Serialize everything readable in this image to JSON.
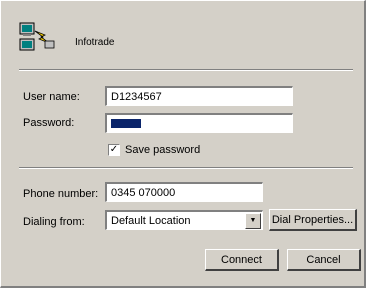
{
  "connection": {
    "name": "Infotrade"
  },
  "fields": {
    "username_label": "User name:",
    "username_value": "D1234567",
    "password_label": "Password:",
    "save_password_label": "Save password",
    "save_password_checked": true,
    "phone_label": "Phone number:",
    "phone_value": "0345 070000",
    "dialing_label": "Dialing from:",
    "dialing_value": "Default Location"
  },
  "buttons": {
    "dial_properties": "Dial Properties...",
    "connect": "Connect",
    "cancel": "Cancel"
  },
  "icons": {
    "connection": "dialup-connection-icon",
    "dropdown": "chevron-down-icon",
    "check": "check-icon"
  }
}
